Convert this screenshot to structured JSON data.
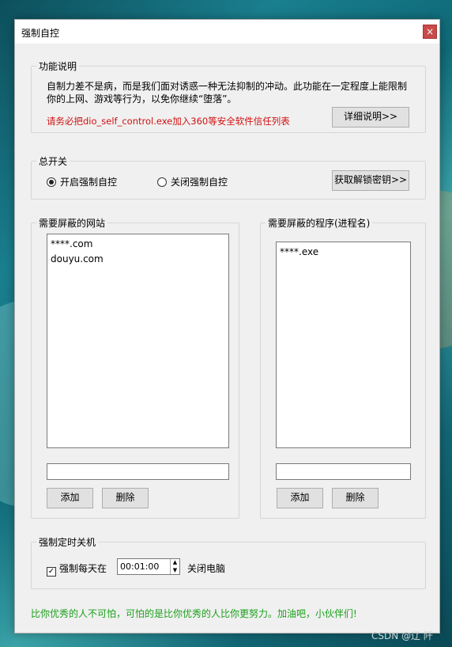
{
  "window": {
    "title": "强制自控",
    "close_glyph": "×"
  },
  "description": {
    "legend": "功能说明",
    "text_line1": "自制力差不是病，而是我们面对诱惑一种无法抑制的冲动。此功能在一定程度上能限制",
    "text_line2": "你的上网、游戏等行为，以免你继续“堕落”。",
    "warning": "请务必把dio_self_control.exe加入360等安全软件信任列表",
    "detail_button": "详细说明>>"
  },
  "master_switch": {
    "legend": "总开关",
    "option_on": "开启强制自控",
    "option_off": "关闭强制自控",
    "selected": "on",
    "unlock_button": "获取解锁密钥>>"
  },
  "websites": {
    "legend": "需要屏蔽的网站",
    "items": [
      "****.com",
      "douyu.com"
    ],
    "input_value": "",
    "add_button": "添加",
    "delete_button": "删除"
  },
  "programs": {
    "legend": "需要屏蔽的程序(进程名)",
    "items": [
      "****.exe"
    ],
    "input_value": "",
    "add_button": "添加",
    "delete_button": "删除"
  },
  "shutdown": {
    "legend": "强制定时关机",
    "checkbox_label": "强制每天在",
    "checked": true,
    "time_value": "00:01:00",
    "suffix": "关闭电脑"
  },
  "footer": {
    "motto": "比你优秀的人不可怕，可怕的是比你优秀的人比你更努力。加油吧，小伙伴们!",
    "motto_color": "#1aa01a"
  },
  "watermark": "CSDN @辽 阡",
  "colors": {
    "warning": "#d01010"
  }
}
